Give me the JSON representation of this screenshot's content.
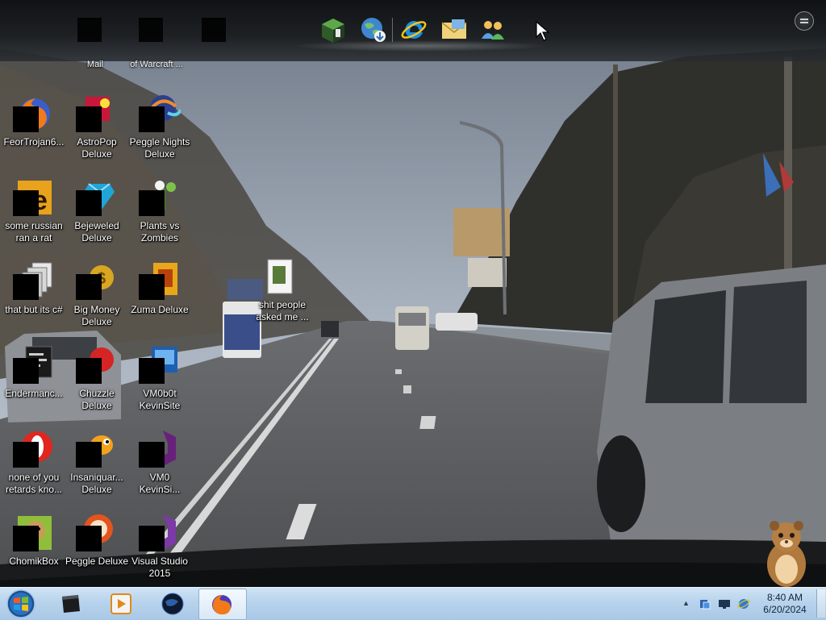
{
  "desktop": {
    "top_row_partial": [
      {
        "label": "Mail"
      },
      {
        "label": "of Warcraft ..."
      }
    ],
    "icons": [
      {
        "label_lines": [
          "FeorTrojan6..."
        ],
        "icon": "firefox-icon"
      },
      {
        "label_lines": [
          "some russian",
          "ran a rat"
        ],
        "icon": "mediaeditor-icon"
      },
      {
        "label_lines": [
          "that but its c#"
        ],
        "icon": "stack-pages-icon"
      },
      {
        "label_lines": [
          "Endermanc..."
        ],
        "icon": "console-window-icon"
      },
      {
        "label_lines": [
          "none of you",
          "retards kno..."
        ],
        "icon": "opera-icon"
      },
      {
        "label_lines": [
          "ChomikBox"
        ],
        "icon": "hamster-box-icon"
      },
      {
        "label_lines": [
          "AstroPop",
          "Deluxe"
        ],
        "icon": "astropop-icon"
      },
      {
        "label_lines": [
          "Bejeweled",
          "Deluxe"
        ],
        "icon": "gem-icon"
      },
      {
        "label_lines": [
          "Big Money",
          "Deluxe"
        ],
        "icon": "money-icon"
      },
      {
        "label_lines": [
          "Chuzzle",
          "Deluxe"
        ],
        "icon": "chuzzle-icon"
      },
      {
        "label_lines": [
          "Insaniquar...",
          "Deluxe"
        ],
        "icon": "fish-icon"
      },
      {
        "label_lines": [
          "Peggle Deluxe"
        ],
        "icon": "peggle-icon"
      },
      {
        "label_lines": [
          "Peggle Nights",
          "Deluxe"
        ],
        "icon": "peggle-nights-icon"
      },
      {
        "label_lines": [
          "Plants vs",
          "Zombies"
        ],
        "icon": "plant-icon"
      },
      {
        "label_lines": [
          "Zuma Deluxe"
        ],
        "icon": "zuma-icon"
      },
      {
        "label_lines": [
          "VM0b0t",
          "KevinSite"
        ],
        "icon": "virtual-machine-icon"
      },
      {
        "label_lines": [
          "VM0",
          "KevinSi..."
        ],
        "icon": "visual-studio-icon"
      },
      {
        "label_lines": [
          "Visual Studio",
          "2015"
        ],
        "icon": "visual-studio-icon"
      },
      {
        "label_lines": [
          "shit people",
          "asked me ..."
        ],
        "icon": "document-icon"
      }
    ]
  },
  "dock": {
    "items": [
      {
        "icon": "minecraft-block-icon"
      },
      {
        "icon": "globe-download-icon"
      },
      {
        "icon": "internet-explorer-icon"
      },
      {
        "icon": "mail-envelope-icon"
      },
      {
        "icon": "messenger-people-icon"
      }
    ]
  },
  "taskbar": {
    "pinned": [
      {
        "icon": "terminal-icon"
      },
      {
        "icon": "media-player-icon"
      },
      {
        "icon": "dark-globe-icon"
      },
      {
        "icon": "firefox-icon",
        "active": true
      }
    ],
    "tray": {
      "icons": [
        "network-icon",
        "monitor-icon",
        "ie-update-icon"
      ],
      "time": "8:40 AM",
      "date": "6/20/2024"
    }
  },
  "colors": {
    "taskbar": "#b7d3ec",
    "dock": "#1e2124",
    "sky": "#a9b3c0",
    "road": "#5a5c5e"
  }
}
